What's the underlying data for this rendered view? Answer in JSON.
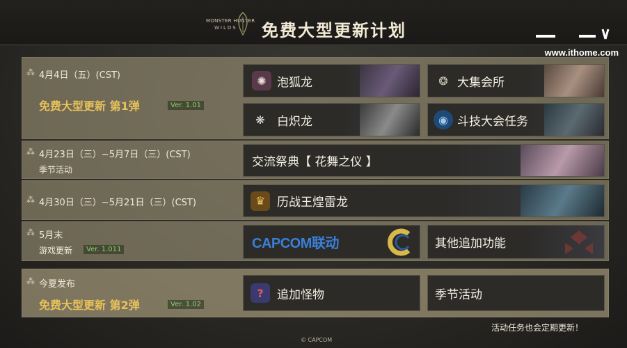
{
  "header": {
    "logo_line1": "MONSTER HUNTER",
    "logo_line2": "WILDS",
    "title": "免费大型更新计划"
  },
  "watermark": "www.ithome.com",
  "rows": [
    {
      "date": "4月4日（五）(CST)",
      "headline": "免费大型更新 第1弹",
      "version": "Ver. 1.01",
      "cards": [
        "泡狐龙",
        "大集会所",
        "白炽龙",
        "斗技大会任务"
      ]
    },
    {
      "date": "4月23日（三）~5月7日（三）(CST)",
      "subtitle": "季节活动",
      "cards": [
        "交流祭典【 花舞之仪 】"
      ]
    },
    {
      "date": "4月30日（三）~5月21日（三）(CST)",
      "cards": [
        "历战王煌雷龙"
      ]
    },
    {
      "date": "5月末",
      "subtitle": "游戏更新",
      "version": "Ver. 1.011",
      "cards": [
        "CAPCOM联动",
        "其他追加功能"
      ]
    },
    {
      "date": "今夏发布",
      "headline": "免费大型更新 第2弹",
      "version": "Ver. 1.02",
      "cards": [
        "追加怪物",
        "季节活动"
      ]
    }
  ],
  "footnote": "活动任务也会定期更新！",
  "copyright": "© CAPCOM",
  "colors": {
    "headline": "#e8c25a",
    "version": "#8fcf6a",
    "capcom_blue": "#3a7fd8"
  }
}
